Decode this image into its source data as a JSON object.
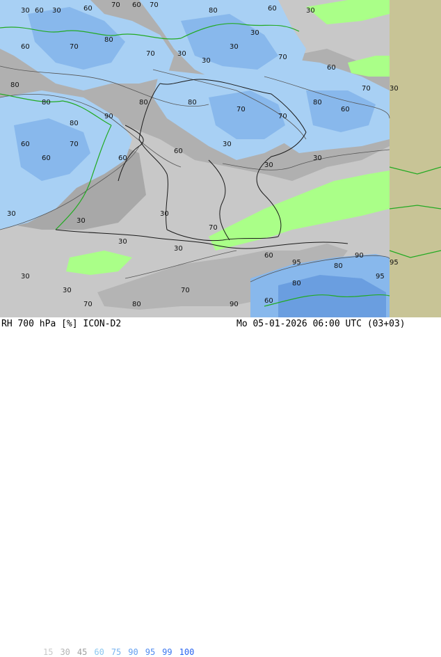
{
  "footer": {
    "title": "RH 700 hPa [%] ICON-D2",
    "datetime": "Mo 05-01-2026 06:00 UTC (03+03)"
  },
  "legend": [
    {
      "label": "15",
      "color": "#c8c8c8"
    },
    {
      "label": "30",
      "color": "#b4b4b4"
    },
    {
      "label": "45",
      "color": "#a0a0a0"
    },
    {
      "label": "60",
      "color": "#8cc8f0"
    },
    {
      "label": "75",
      "color": "#78b4f0"
    },
    {
      "label": "90",
      "color": "#64a0f0"
    },
    {
      "label": "95",
      "color": "#508cf0"
    },
    {
      "label": "99",
      "color": "#3c78f0"
    },
    {
      "label": "100",
      "color": "#2864f0"
    }
  ],
  "colors": {
    "background": "#c8c8c8",
    "dry_band": "#aaff88",
    "moist_light": "#a8d0f4",
    "moist_mid": "#88b8ec",
    "moist_dark": "#6a9ee0",
    "gray_zone": "#9c9c9c",
    "right_strip": "#c8c496",
    "coastline": "#22aa22",
    "border": "#1a1a1a"
  },
  "contour_labels": [
    "30",
    "60",
    "30",
    "60",
    "70",
    "60",
    "70",
    "80",
    "60",
    "30",
    "60",
    "70",
    "80",
    "70",
    "30",
    "30",
    "30",
    "30",
    "70",
    "60",
    "80",
    "80",
    "80",
    "90",
    "80",
    "80",
    "70",
    "70",
    "80",
    "60",
    "70",
    "30",
    "60",
    "60",
    "70",
    "60",
    "60",
    "30",
    "30",
    "30",
    "30",
    "30",
    "30",
    "30",
    "30",
    "70",
    "60",
    "95",
    "80",
    "90",
    "95",
    "95",
    "30",
    "30",
    "70",
    "80",
    "70",
    "90",
    "60",
    "80"
  ]
}
